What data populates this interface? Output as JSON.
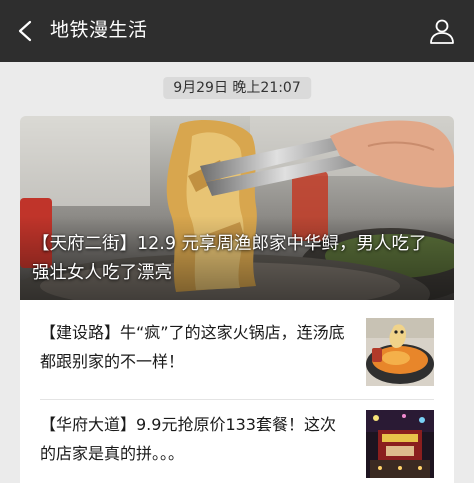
{
  "header": {
    "title": "地铁漫生活",
    "back_icon": "chevron-left-icon",
    "profile_icon": "person-icon"
  },
  "timestamp": "9月29日 晚上21:07",
  "hero": {
    "title": "【天府二街】12.9 元享周渔郎家中华鲟，男人吃了强壮女人吃了漂亮"
  },
  "articles": [
    {
      "title": "【建设路】牛“疯”了的这家火锅店，连汤底都跟别家的不一样！"
    },
    {
      "title": "【华府大道】9.9元抢原价133套餐！这次的店家是真的拼。。。"
    }
  ],
  "colors": {
    "topbar": "#2e2e2e",
    "background": "#ebebeb",
    "card": "#ffffff"
  }
}
